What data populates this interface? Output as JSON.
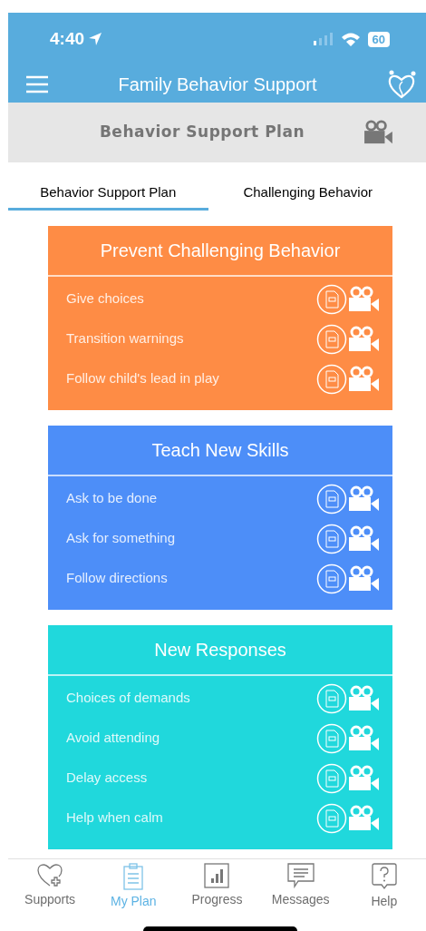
{
  "status_bar": {
    "time": "4:40",
    "battery": "60"
  },
  "app_bar": {
    "title": "Family Behavior Support"
  },
  "page_header": {
    "title": "Behavior Support Plan"
  },
  "tabs": [
    {
      "label": "Behavior Support Plan",
      "selected": true
    },
    {
      "label": "Challenging Behavior",
      "selected": false
    }
  ],
  "sections": [
    {
      "title": "Prevent Challenging Behavior",
      "color": "#fe8c45",
      "items": [
        "Give choices",
        "Transition warnings",
        "Follow child's lead in play"
      ]
    },
    {
      "title": "Teach New Skills",
      "color": "#4d8ef8",
      "items": [
        "Ask to be done",
        "Ask for something",
        "Follow directions"
      ]
    },
    {
      "title": "New Responses",
      "color": "#20d8dc",
      "items": [
        "Choices of demands",
        "Avoid attending",
        "Delay access",
        "Help when calm"
      ]
    }
  ],
  "bottom_nav": [
    {
      "label": "Supports",
      "kind": "heart",
      "selected": false
    },
    {
      "label": "My Plan",
      "kind": "clipboard",
      "selected": true
    },
    {
      "label": "Progress",
      "kind": "chart",
      "selected": false
    },
    {
      "label": "Messages",
      "kind": "message",
      "selected": false
    },
    {
      "label": "Help",
      "kind": "help",
      "selected": false
    }
  ]
}
